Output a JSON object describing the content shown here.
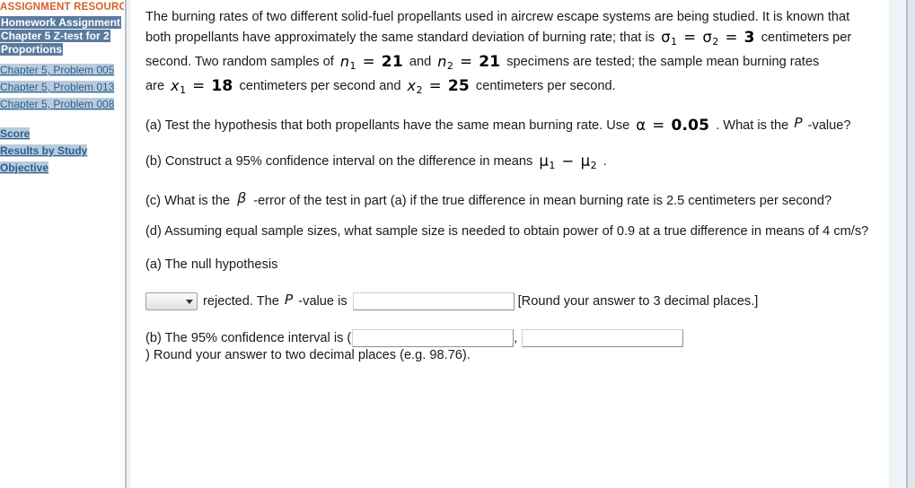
{
  "sidebar": {
    "heading": "ASSIGNMENT RESOURCES",
    "assignment_line1": "Homework Assignment",
    "assignment_line2": "Chapter 5 Z-test for 2",
    "assignment_line3": "Proportions",
    "links": [
      "Chapter 5, Problem 005",
      "Chapter 5, Problem 013",
      "Chapter 5, Problem 008"
    ],
    "footer_links": [
      "Score",
      "Results by Study",
      "Objective"
    ]
  },
  "problem": {
    "intro_a": "The burning rates of two different solid-fuel propellants used in aircrew escape systems are being studied. It is known that both propellants have approximately the same standard deviation of burning rate; that is",
    "math_sigma": "σ₁ = σ₂ = 3",
    "intro_b": "centimeters per second. Two random samples of",
    "math_n1": "n₁ = 21",
    "intro_c": "and",
    "math_n2": "n₂ = 21",
    "intro_d": "specimens are tested; the sample mean burning rates are",
    "math_x1": "x₁ = 18",
    "intro_e": "centimeters per second and",
    "math_x2": "x₂ = 25",
    "intro_f": "centimeters per second.",
    "part_a_1": "(a) Test the hypothesis that both propellants have the same mean burning rate. Use",
    "math_alpha": "α = 0.05",
    "part_a_2": ". What is the",
    "math_P_a": "P",
    "part_a_3": "-value?",
    "part_b_1": "(b) Construct a 95% confidence interval on the difference in means",
    "math_mu": "μ₁ − μ₂",
    "part_b_2": ".",
    "part_c_1": "(c) What is the",
    "math_beta": "β",
    "part_c_2": "-error of the test in part (a) if the true difference in mean burning rate is 2.5 centimeters per second?",
    "part_d": "(d) Assuming equal sample sizes, what sample size is needed to obtain power of 0.9 at a true difference in means of 4 cm/s?"
  },
  "answers": {
    "a_label": "(a) The null hypothesis",
    "a_select_value": "",
    "a_after_select": "rejected. The",
    "math_P_ans": "P",
    "a_pvalue_text": "-value is",
    "a_pvalue_input": "",
    "a_hint": "[Round your answer to 3 decimal places.]",
    "b_label": "(b) The 95% confidence interval is (",
    "b_input_low": "",
    "b_comma": ",",
    "b_input_high": "",
    "b_close": ") Round your answer to two decimal places (e.g. 98.76)."
  },
  "colors": {
    "heading_orange": "#d2622a",
    "link_blue": "#2a5f8f",
    "selection_blue": "#b9cbdc",
    "assignment_highlight": "#5a7b9e",
    "divider_gray": "#b7bec6",
    "panel_tint": "#eef3f8"
  }
}
